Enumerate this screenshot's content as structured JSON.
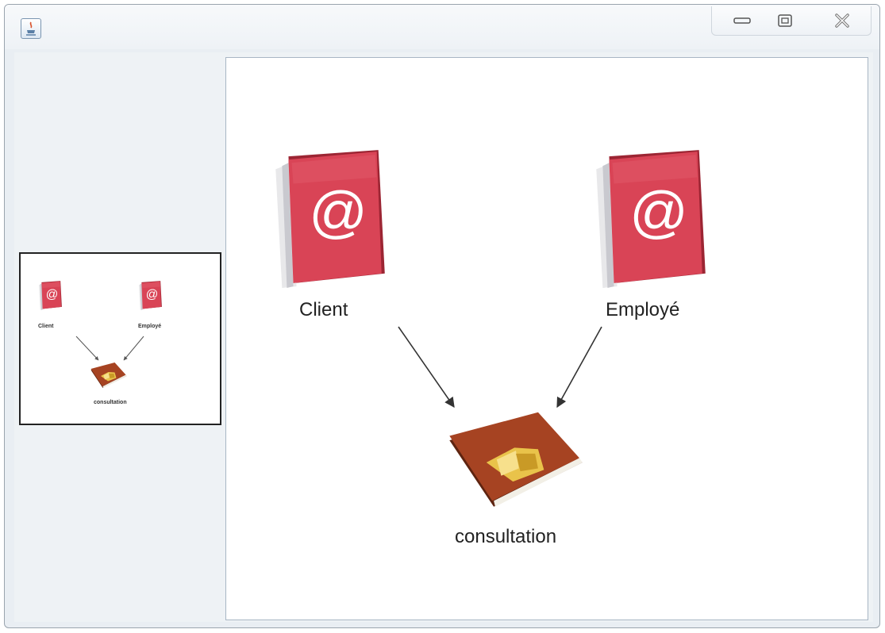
{
  "window": {
    "title": "",
    "controls": [
      "minimize",
      "maximize",
      "close"
    ],
    "icons": {
      "app": "java-app-icon",
      "minimize": "minimize-icon",
      "maximize": "maximize-icon",
      "close": "close-icon"
    }
  },
  "graph": {
    "nodes": [
      {
        "id": "client",
        "label": "Client",
        "icon": "address-book-icon"
      },
      {
        "id": "employe",
        "label": "Employé",
        "icon": "address-book-icon"
      },
      {
        "id": "consultation",
        "label": "consultation",
        "icon": "gold-book-icon"
      }
    ],
    "edges": [
      {
        "from": "Client",
        "to": "consultation"
      },
      {
        "from": "Employé",
        "to": "consultation"
      }
    ]
  },
  "overview": {
    "labels": [
      "Client",
      "Employé",
      "consultation"
    ]
  },
  "colors": {
    "book_red": "#d94456",
    "book_brown": "#8b3a1c",
    "edge": "#333333"
  }
}
